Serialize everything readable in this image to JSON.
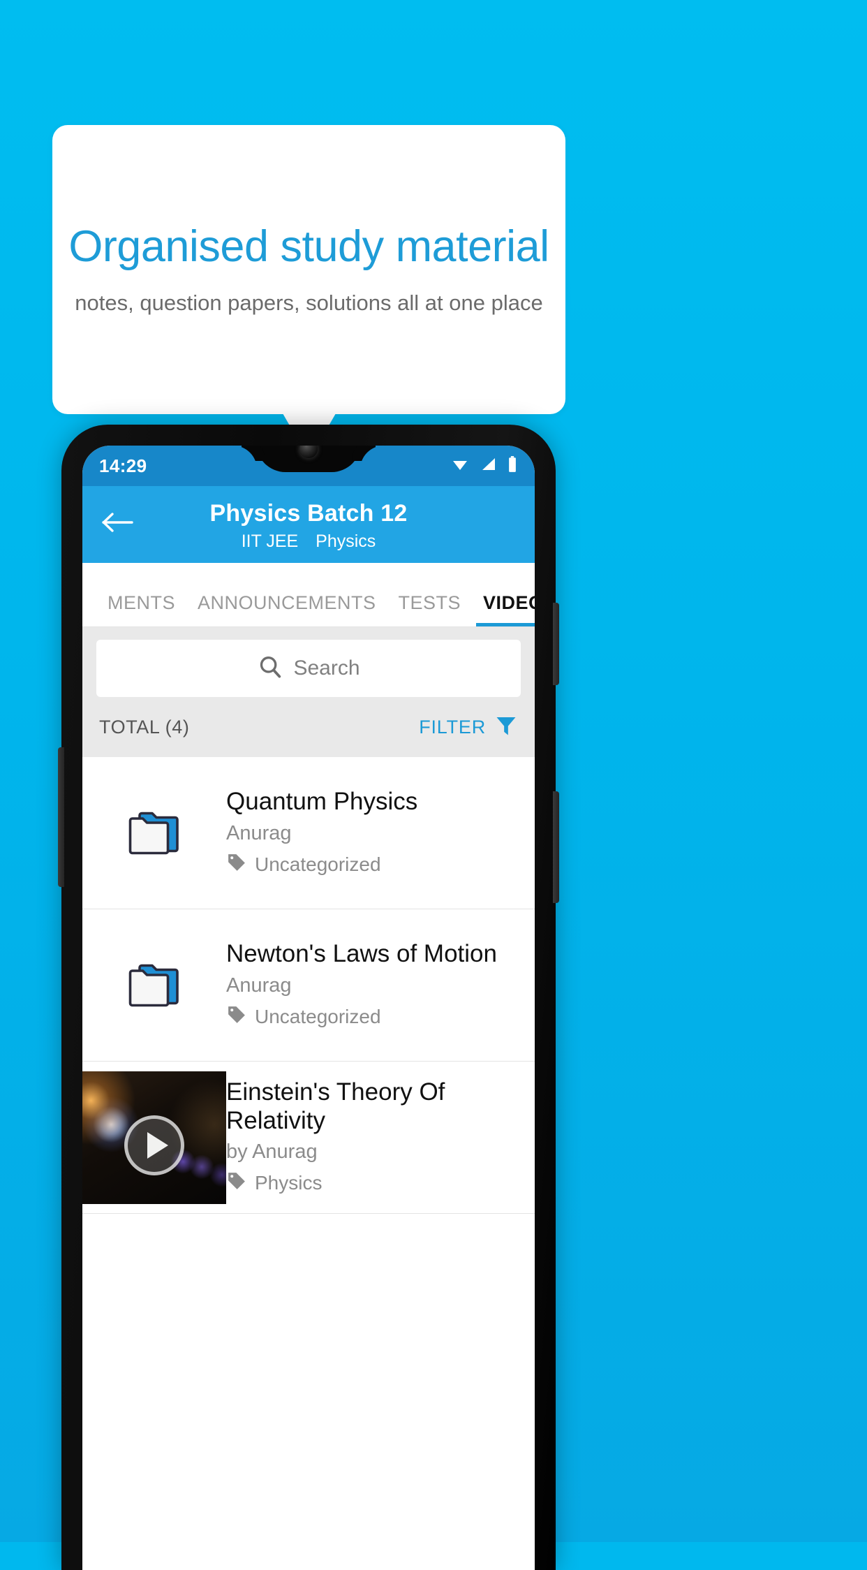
{
  "promo": {
    "headline": "Organised study material",
    "subtitle": "notes, question papers, solutions all at one place",
    "headline_color": "#1e9cd7",
    "background_color": "#00b8ee"
  },
  "phone": {
    "status_bar": {
      "time": "14:29",
      "icons": [
        "wifi-icon",
        "signal-icon",
        "battery-icon"
      ],
      "background_color": "#1787c9"
    },
    "app_bar": {
      "back_icon": "back-arrow-icon",
      "title": "Physics Batch 12",
      "subtitle_exam": "IIT JEE",
      "subtitle_subject": "Physics",
      "background_color": "#22a5e4"
    },
    "tabs": [
      {
        "label": "MENTS",
        "active": false
      },
      {
        "label": "ANNOUNCEMENTS",
        "active": false
      },
      {
        "label": "TESTS",
        "active": false
      },
      {
        "label": "VIDEOS",
        "active": true
      }
    ],
    "search": {
      "placeholder": "Search",
      "value": "",
      "icon": "search-icon"
    },
    "toolbar": {
      "total_label": "TOTAL (4)",
      "filter_label": "FILTER",
      "filter_icon": "filter-funnel-icon",
      "accent_color": "#1c9ad6"
    },
    "list": [
      {
        "kind": "folder",
        "icon": "folder-icon",
        "title": "Quantum Physics",
        "author": "Anurag",
        "tag": "Uncategorized",
        "tag_icon": "tag-icon"
      },
      {
        "kind": "folder",
        "icon": "folder-icon",
        "title": "Newton's Laws of Motion",
        "author": "Anurag",
        "tag": "Uncategorized",
        "tag_icon": "tag-icon"
      },
      {
        "kind": "video",
        "icon": "video-thumbnail",
        "title": "Einstein's Theory Of Relativity",
        "author": "by Anurag",
        "tag": "Physics",
        "tag_icon": "tag-icon",
        "play_icon": "play-icon"
      }
    ]
  }
}
